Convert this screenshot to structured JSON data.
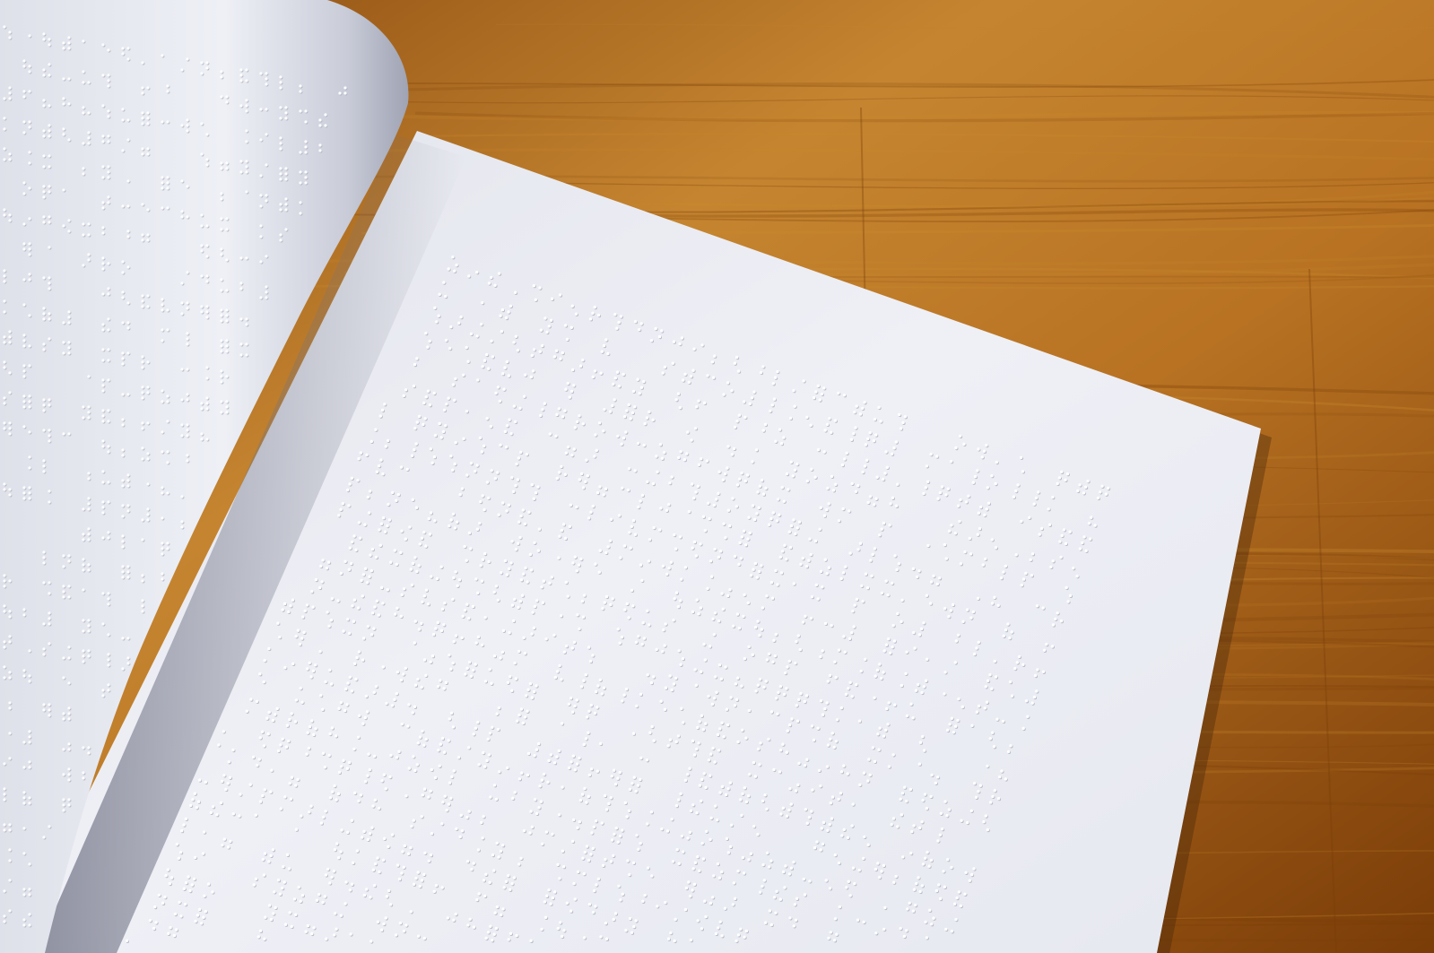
{
  "scene": {
    "subject": "open-braille-book",
    "background": "wooden-table"
  },
  "colors": {
    "wood_light": "#c98a2c",
    "wood_mid": "#b06a18",
    "wood_dark": "#7a3e08",
    "page_white": "#eceef4",
    "page_shadow": "#b9bcc9",
    "curl_light": "#f4f5fa",
    "curl_dark": "#aeb1c0",
    "dot_light": "#ffffff",
    "dot_shadow": "#a9acbb"
  },
  "braille": {
    "right_page_lines": 30,
    "cells_per_line": 38,
    "left_page_lines": 30,
    "left_cells_per_line": 18,
    "fill_ratio": 0.55
  }
}
